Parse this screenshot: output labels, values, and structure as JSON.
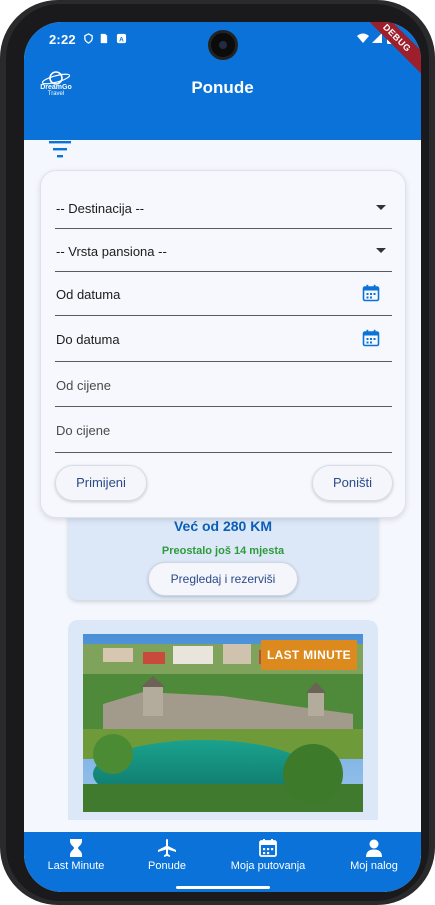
{
  "status": {
    "time": "2:22",
    "debug_label": "DEBUG"
  },
  "app_bar": {
    "title": "Ponude",
    "logo_text": "DreamGo",
    "logo_subtext": "Travel"
  },
  "filters": {
    "destination": "-- Destinacija --",
    "board_type": "-- Vrsta pansiona --",
    "date_from": "Od datuma",
    "date_to": "Do datuma",
    "price_from": "Od cijene",
    "price_to": "Do cijene",
    "apply_label": "Primijeni",
    "reset_label": "Poništi"
  },
  "offer": {
    "price_text": "Već od 280 KM",
    "places_text": "Preostalo još 14 mjesta",
    "review_label": "Pregledaj i rezerviši"
  },
  "featured": {
    "badge": "LAST MINUTE"
  },
  "nav": [
    {
      "label": "Last Minute",
      "icon": "hourglass-icon"
    },
    {
      "label": "Ponude",
      "icon": "airplane-icon"
    },
    {
      "label": "Moja putovanja",
      "icon": "calendar-icon"
    },
    {
      "label": "Moj nalog",
      "icon": "person-icon"
    }
  ],
  "colors": {
    "primary": "#0a72d8",
    "accent_orange": "#dc8a1e",
    "green": "#2e9a3c",
    "card_bg": "#dce8f8"
  }
}
